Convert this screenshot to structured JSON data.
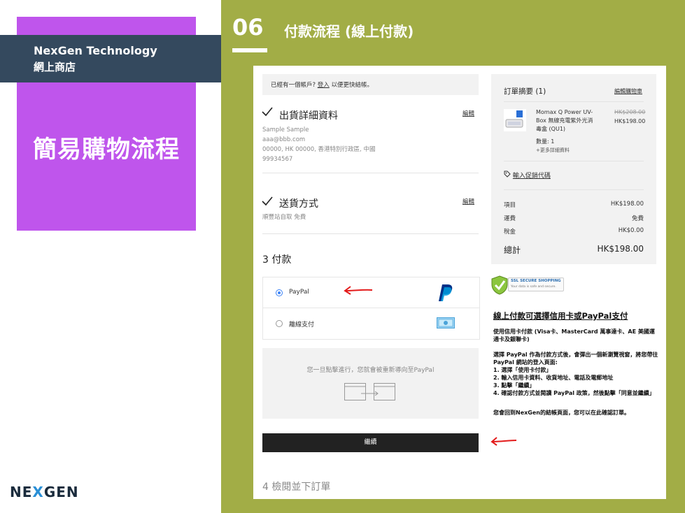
{
  "company": {
    "name": "NexGen Technology",
    "subtitle": "網上商店"
  },
  "main_title": "簡易購物流程",
  "logo": {
    "left": "NE",
    "x": "X",
    "right": "GEN"
  },
  "step": {
    "number": "06",
    "title": "付款流程 (線上付款)"
  },
  "checkout": {
    "login_prompt": "已經有一個帳戶?",
    "login_link": "登入",
    "login_suffix": "以便更快結帳。",
    "shipping_details": {
      "title": "出貨詳細資料",
      "edit": "編輯",
      "name": "Sample Sample",
      "email": "aaa@bbb.com",
      "address": "00000, HK 00000, 香港特別行政區, 中國",
      "phone": "99934567"
    },
    "delivery": {
      "title": "送貨方式",
      "edit": "編輯",
      "method": "順豐站自取 免費"
    },
    "payment": {
      "title": "3 付款",
      "options": [
        {
          "label": "PayPal",
          "selected": true
        },
        {
          "label": "離線支付",
          "selected": false
        }
      ],
      "redirect_note": "您一旦點擊進行，您就會被重新導向至PayPal"
    },
    "continue_button": "繼續",
    "review_step": "4 檢閱並下訂單"
  },
  "order_summary": {
    "title": "訂單摘要 (1)",
    "edit_cart": "編輯購物車",
    "product": {
      "name": "Momax Q Power UV-Box 無線充電紫外光消毒盒 (QU1)",
      "original_price": "HK$208.00",
      "price": "HK$198.00",
      "qty": "數量: 1",
      "more": "+更多詳細資料"
    },
    "promo": "輸入促銷代碼",
    "rows": [
      {
        "label": "項目",
        "value": "HK$198.00"
      },
      {
        "label": "運費",
        "value": "免費"
      },
      {
        "label": "稅金",
        "value": "HK$0.00"
      }
    ],
    "total_label": "總計",
    "total_value": "HK$198.00"
  },
  "ssl": {
    "title": "SSL SECURE SHOPPING",
    "subtitle": "Your data is safe and secure."
  },
  "instructions": {
    "title": "線上付款可選擇信用卡或PayPal支付",
    "para1": "使用信用卡付款 (Visa卡、MasterCard 萬事達卡、AE 美國運通卡及銀聯卡)",
    "para2_intro": "選擇 PayPal 作為付款方式後，會彈出一個新瀏覽視窗，將您帶往 PayPal 網站的登入頁面:",
    "steps": [
      "1. 選擇「使用卡付款」",
      "2. 輸入信用卡資料、收貨地址、電話及電郵地址",
      "3. 點擊「繼續」",
      "4. 確認付款方式並閱讀 PayPal 政策，然後點擊「同意並繼續」"
    ],
    "para3": "您會回到NexGen的結帳頁面，您可以在此確認訂單。"
  },
  "colors": {
    "purple": "#bf55ec",
    "navy": "#34495e",
    "olive": "#a2ad46",
    "arrow": "#e31b1b",
    "paypal": "#003087"
  }
}
